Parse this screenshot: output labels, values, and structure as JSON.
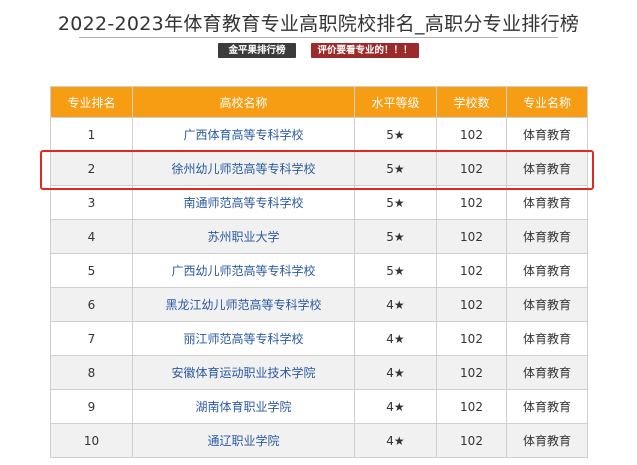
{
  "title": "2022-2023年体育教育专业高职院校排名_高职分专业排行榜",
  "badges": [
    "金平果排行榜",
    "评价要看专业的！！！"
  ],
  "table": {
    "headers": [
      "专业排名",
      "高校名称",
      "水平等级",
      "学校数",
      "专业名称"
    ],
    "rows": [
      {
        "rank": "1",
        "school": "广西体育高等专科学校",
        "level": "5★",
        "count": "102",
        "major": "体育教育"
      },
      {
        "rank": "2",
        "school": "徐州幼儿师范高等专科学校",
        "level": "5★",
        "count": "102",
        "major": "体育教育"
      },
      {
        "rank": "3",
        "school": "南通师范高等专科学校",
        "level": "5★",
        "count": "102",
        "major": "体育教育"
      },
      {
        "rank": "4",
        "school": "苏州职业大学",
        "level": "5★",
        "count": "102",
        "major": "体育教育"
      },
      {
        "rank": "5",
        "school": "广西幼儿师范高等专科学校",
        "level": "5★",
        "count": "102",
        "major": "体育教育"
      },
      {
        "rank": "6",
        "school": "黑龙江幼儿师范高等专科学校",
        "level": "4★",
        "count": "102",
        "major": "体育教育"
      },
      {
        "rank": "7",
        "school": "丽江师范高等专科学校",
        "level": "4★",
        "count": "102",
        "major": "体育教育"
      },
      {
        "rank": "8",
        "school": "安徽体育运动职业技术学院",
        "level": "4★",
        "count": "102",
        "major": "体育教育"
      },
      {
        "rank": "9",
        "school": "湖南体育职业学院",
        "level": "4★",
        "count": "102",
        "major": "体育教育"
      },
      {
        "rank": "10",
        "school": "通辽职业学院",
        "level": "4★",
        "count": "102",
        "major": "体育教育"
      }
    ]
  },
  "highlight_color": "#e2291f",
  "header_color": "#f79d14"
}
